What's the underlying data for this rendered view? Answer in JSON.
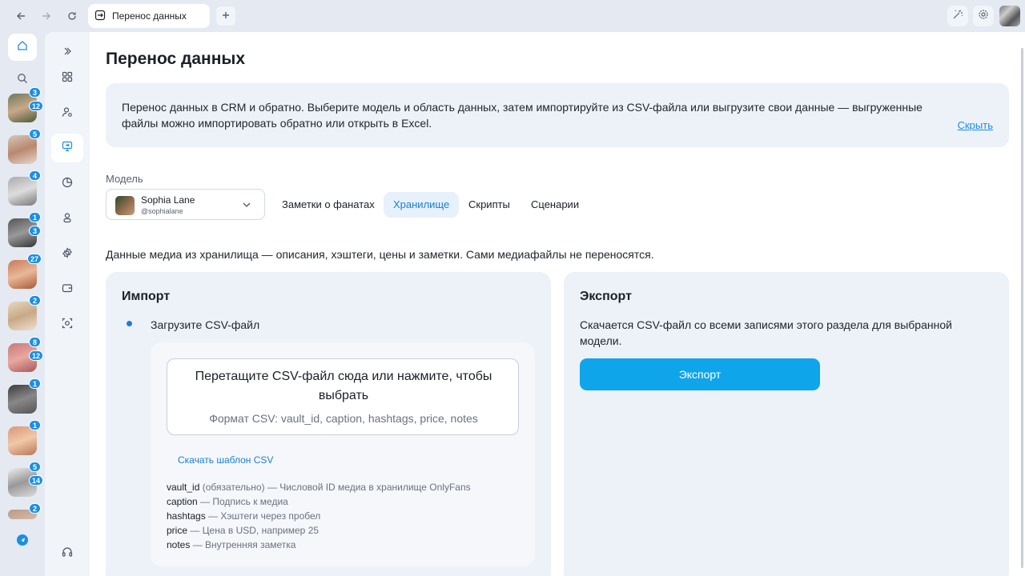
{
  "browser": {
    "tab_title": "Перенос данных"
  },
  "rail": {
    "creators": [
      {
        "badges": [
          "3",
          "12"
        ]
      },
      {
        "badges": [
          "5"
        ]
      },
      {
        "badges": [
          "4"
        ]
      },
      {
        "badges": [
          "1",
          "3"
        ]
      },
      {
        "badges": [
          "27"
        ]
      },
      {
        "badges": [
          "2"
        ]
      },
      {
        "badges": [
          "8",
          "12"
        ]
      },
      {
        "badges": [
          "1"
        ]
      },
      {
        "badges": [
          "1"
        ]
      },
      {
        "badges": [
          "5",
          "14"
        ]
      },
      {
        "badges": [
          "2"
        ]
      }
    ]
  },
  "page": {
    "title": "Перенос данных",
    "info_text": "Перенос данных в CRM и обратно. Выберите модель и область данных, затем импортируйте из CSV-файла или выгрузите свои данные — выгруженные файлы можно импортировать обратно или открыть в Excel.",
    "hide_link": "Скрыть",
    "model_label": "Модель",
    "model": {
      "name": "Sophia Lane",
      "handle": "@sophialane"
    },
    "tabs": [
      "Заметки о фанатах",
      "Хранилище",
      "Скрипты",
      "Сценарии"
    ],
    "active_tab": "Хранилище",
    "section_description": "Данные медиа из хранилища — описания, хэштеги, цены и заметки. Сами медиафайлы не переносятся."
  },
  "import": {
    "title": "Импорт",
    "step_label": "Загрузите CSV-файл",
    "dropzone_title": "Перетащите CSV-файл сюда или нажмите, чтобы выбрать",
    "dropzone_hint": "Формат CSV: vault_id, caption, hashtags, price, notes",
    "template_link": "Скачать шаблон CSV",
    "fields": [
      {
        "key": "vault_id",
        "extra": " (обязательно)",
        "desc": " — Числовой ID медиа в хранилище OnlyFans"
      },
      {
        "key": "caption",
        "extra": "",
        "desc": " — Подпись к медиа"
      },
      {
        "key": "hashtags",
        "extra": "",
        "desc": " — Хэштеги через пробел"
      },
      {
        "key": "price",
        "extra": "",
        "desc": " — Цена в USD, например 25"
      },
      {
        "key": "notes",
        "extra": "",
        "desc": " — Внутренняя заметка"
      }
    ]
  },
  "export": {
    "title": "Экспорт",
    "text": "Скачается CSV-файл со всеми записями этого раздела для выбранной модели.",
    "button_label": "Экспорт"
  },
  "colors": {
    "accent": "#1a7fd0",
    "export_button": "#0ea5ea",
    "badge": "#1a8fe3"
  }
}
